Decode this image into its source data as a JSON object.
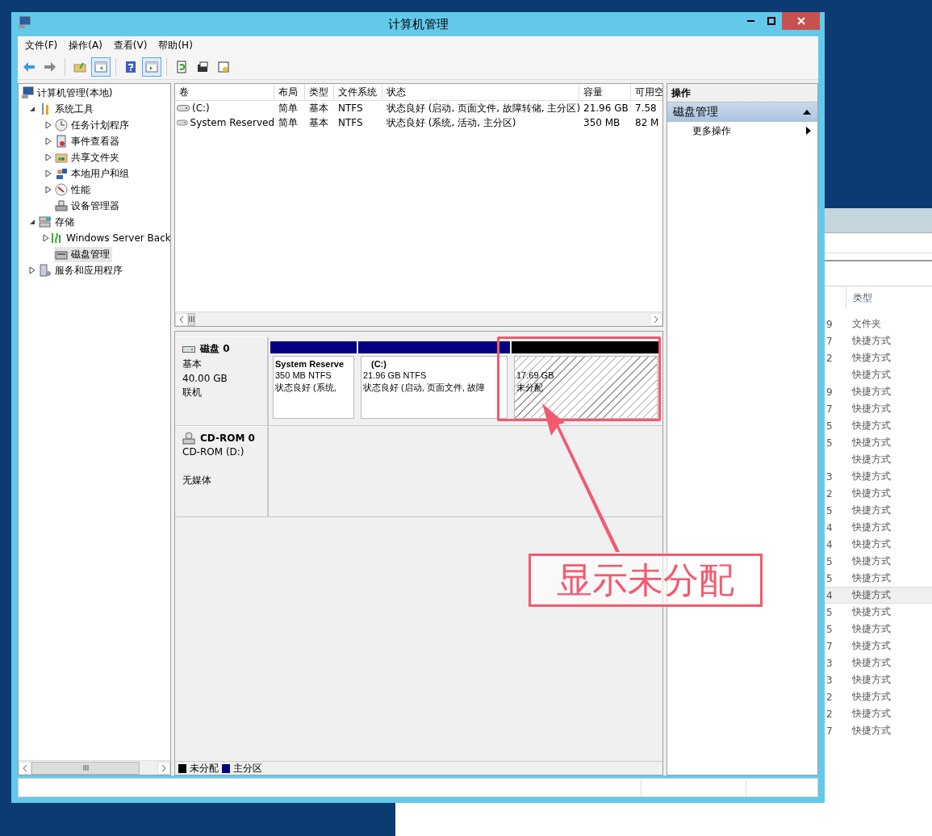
{
  "window": {
    "title": "计算机管理"
  },
  "menu": [
    {
      "label": "文件(F)"
    },
    {
      "label": "操作(A)"
    },
    {
      "label": "查看(V)"
    },
    {
      "label": "帮助(H)"
    }
  ],
  "toolbar": [
    {
      "kind": "back",
      "pressed": false
    },
    {
      "kind": "forward",
      "pressed": false
    },
    {
      "kind": "sep"
    },
    {
      "kind": "up",
      "pressed": false
    },
    {
      "kind": "tree",
      "pressed": true
    },
    {
      "kind": "sep"
    },
    {
      "kind": "help",
      "pressed": false
    },
    {
      "kind": "actionpane",
      "pressed": true
    },
    {
      "kind": "sep"
    },
    {
      "kind": "refresh",
      "pressed": false
    },
    {
      "kind": "properties",
      "pressed": false
    },
    {
      "kind": "export",
      "pressed": false
    }
  ],
  "tree": {
    "items": [
      {
        "label": "计算机管理(本地)",
        "kind": "computer",
        "selected": false,
        "children": [
          {
            "label": "系统工具",
            "kind": "tools",
            "expanded": true,
            "selected": false,
            "children": [
              {
                "label": "任务计划程序",
                "kind": "clock",
                "expanded": false,
                "selected": false
              },
              {
                "label": "事件查看器",
                "kind": "log",
                "expanded": false,
                "selected": false
              },
              {
                "label": "共享文件夹",
                "kind": "share",
                "expanded": false,
                "selected": false
              },
              {
                "label": "本地用户和组",
                "kind": "users",
                "expanded": false,
                "selected": false
              },
              {
                "label": "性能",
                "kind": "performance",
                "expanded": false,
                "selected": false
              },
              {
                "label": "设备管理器",
                "kind": "device",
                "selected": false
              }
            ]
          },
          {
            "label": "存储",
            "kind": "storage",
            "expanded": true,
            "selected": false,
            "children": [
              {
                "label": "Windows Server Back",
                "kind": "backup",
                "expanded": false,
                "selected": false
              },
              {
                "label": "磁盘管理",
                "kind": "disk",
                "selected": true
              }
            ]
          },
          {
            "label": "服务和应用程序",
            "kind": "services",
            "expanded": false,
            "selected": false
          }
        ]
      }
    ]
  },
  "volumes": {
    "columns": [
      "卷",
      "布局",
      "类型",
      "文件系统",
      "状态",
      "容量",
      "可用空"
    ],
    "rows": [
      {
        "cells": [
          "(C:)",
          "简单",
          "基本",
          "NTFS",
          "状态良好 (启动, 页面文件, 故障转储, 主分区)",
          "21.96 GB",
          "7.58"
        ]
      },
      {
        "cells": [
          "System Reserved",
          "简单",
          "基本",
          "NTFS",
          "状态良好 (系统, 活动, 主分区)",
          "350 MB",
          "82 M"
        ]
      }
    ]
  },
  "disks": [
    {
      "kind": "disk",
      "name": "磁盘 0",
      "lines": [
        "基本",
        "40.00 GB",
        "联机"
      ],
      "partitions": [
        {
          "kind": "primary",
          "name": "System Reserve",
          "lines": [
            "350 MB NTFS",
            "状态良好 (系统,"
          ]
        },
        {
          "kind": "primary",
          "name": "(C:)",
          "lines": [
            "21.96 GB NTFS",
            "状态良好 (启动, 页面文件, 故障"
          ]
        },
        {
          "kind": "unallocated",
          "lines": [
            "17.69 GB",
            "未分配"
          ]
        }
      ]
    },
    {
      "kind": "cdrom",
      "name": "CD-ROM 0",
      "lines": [
        "CD-ROM (D:)"
      ],
      "note": "无媒体"
    }
  ],
  "legend": [
    {
      "label": "未分配",
      "color": "#000000"
    },
    {
      "label": "主分区",
      "color": "#000080"
    }
  ],
  "actions": {
    "title": "操作",
    "sections": [
      {
        "label": "磁盘管理",
        "expanded": true,
        "items": [
          {
            "label": "更多操作"
          }
        ]
      }
    ]
  },
  "annotation": {
    "label": "显示未分配"
  },
  "background_window": {
    "column": "类型",
    "rows": [
      {
        "cell": "9",
        "type": "文件夹",
        "selected": false
      },
      {
        "cell": "7",
        "type": "快捷方式",
        "selected": false
      },
      {
        "cell": "2",
        "type": "快捷方式",
        "selected": false
      },
      {
        "type": "快捷方式",
        "selected": false
      },
      {
        "cell": "9",
        "type": "快捷方式",
        "selected": false
      },
      {
        "cell": "7",
        "type": "快捷方式",
        "selected": false
      },
      {
        "cell": "5",
        "type": "快捷方式",
        "selected": false
      },
      {
        "cell": "5",
        "type": "快捷方式",
        "selected": false
      },
      {
        "type": "快捷方式",
        "selected": false
      },
      {
        "cell": "3",
        "type": "快捷方式",
        "selected": false
      },
      {
        "cell": "2",
        "type": "快捷方式",
        "selected": false
      },
      {
        "cell": "5",
        "type": "快捷方式",
        "selected": false
      },
      {
        "cell": "4",
        "type": "快捷方式",
        "selected": false
      },
      {
        "cell": "4",
        "type": "快捷方式",
        "selected": false
      },
      {
        "cell": "5",
        "type": "快捷方式",
        "selected": false
      },
      {
        "cell": "5",
        "type": "快捷方式",
        "selected": false
      },
      {
        "cell": "4",
        "type": "快捷方式",
        "selected": true
      },
      {
        "cell": "5",
        "type": "快捷方式",
        "selected": false
      },
      {
        "cell": "5",
        "type": "快捷方式",
        "selected": false
      },
      {
        "cell": "7",
        "type": "快捷方式",
        "selected": false
      },
      {
        "cell": "3",
        "type": "快捷方式",
        "selected": false
      },
      {
        "cell": "3",
        "type": "快捷方式",
        "selected": false
      },
      {
        "cell": "2",
        "type": "快捷方式",
        "selected": false
      },
      {
        "cell": "2",
        "type": "快捷方式",
        "selected": false
      },
      {
        "cell": "7",
        "type": "快捷方式",
        "selected": false
      }
    ]
  }
}
